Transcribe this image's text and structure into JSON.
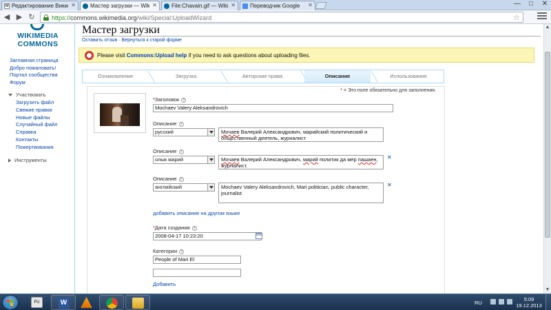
{
  "browser": {
    "tabs": [
      {
        "label": "Редактирование Википедия",
        "active": false
      },
      {
        "label": "Мастер загрузки — Wiki",
        "active": true
      },
      {
        "label": "File:Chavain.gif — Wikim",
        "active": false
      },
      {
        "label": "Переводчик Google",
        "active": false
      }
    ],
    "url_protocol": "https://",
    "url_host": "commons.wikimedia.org",
    "url_path": "/wiki/Special:UploadWizard",
    "window_controls": {
      "minimize": "—",
      "maximize": "□",
      "close": "✕"
    }
  },
  "logo": {
    "line1": "WIKIMEDIA",
    "line2": "COMMONS"
  },
  "sidebar": {
    "nav": [
      "Заглавная страница",
      "Добро пожаловать!",
      "Портал сообщества",
      "Форум"
    ],
    "participate_heading": "Участвовать",
    "participate_items": [
      "Загрузить файл",
      "Свежие правки",
      "Новые файлы",
      "Случайный файл",
      "Справка",
      "Контакты",
      "Пожертвования"
    ],
    "tools_heading": "Инструменты"
  },
  "page": {
    "title": "Мастер загрузки",
    "feedback_link": "Оставить отзыв",
    "separator": "·",
    "old_form_link": "Вернуться к старой форме",
    "notice_prefix": "Please visit ",
    "notice_link": "Commons:Upload help",
    "notice_suffix": " if you need to ask questions about uploading files."
  },
  "steps": [
    "Ознакомление",
    "Загрузка",
    "Авторские права",
    "Описание",
    "Использование"
  ],
  "active_step": "Описание",
  "form": {
    "required_note": "= Это поле обязательно для заполнения.",
    "required_mark": "*",
    "title_label": "Заголовок",
    "title_value": "Mochaev Valery Aleksandrovich",
    "description_label": "Описание",
    "descriptions": [
      {
        "language": "русский",
        "text_a": "Мочаев",
        "text_b": " Валерий Александрович, марийский политический и общественный деятель, журналист",
        "removable": false
      },
      {
        "language": "олык марий",
        "text_a": "Мочаев",
        "text_b": " Валерий Александрович, ",
        "text_c": "марий",
        "text_d": " политик да мер ",
        "text_e": "пашаен",
        "text_f": ", журналист.",
        "removable": true
      },
      {
        "language": "английский",
        "text_a": "Mochaev Valery Aleksandrovich, Mari politician, public character, journalist",
        "removable": true
      }
    ],
    "remove_icon": "✕",
    "add_description_link": "добавить описание на другом языке",
    "date_label": "Дата создания",
    "date_value": "2008-04-17 10:23:20",
    "categories_label": "Категории",
    "category_1": "People of Mari El",
    "category_2": "",
    "add_link": "Добавить"
  },
  "taskbar": {
    "language": "RU",
    "time": "5:09",
    "date": "19.12.2013",
    "pinned": [
      "explorer-fu-icon",
      "word-icon",
      "vlc-icon",
      "chrome-icon",
      "folder-icon"
    ]
  },
  "colors": {
    "link": "#0645ad",
    "notice_bg": "#fbf5b6",
    "step_border": "#a7d7f9",
    "required": "#c00"
  }
}
